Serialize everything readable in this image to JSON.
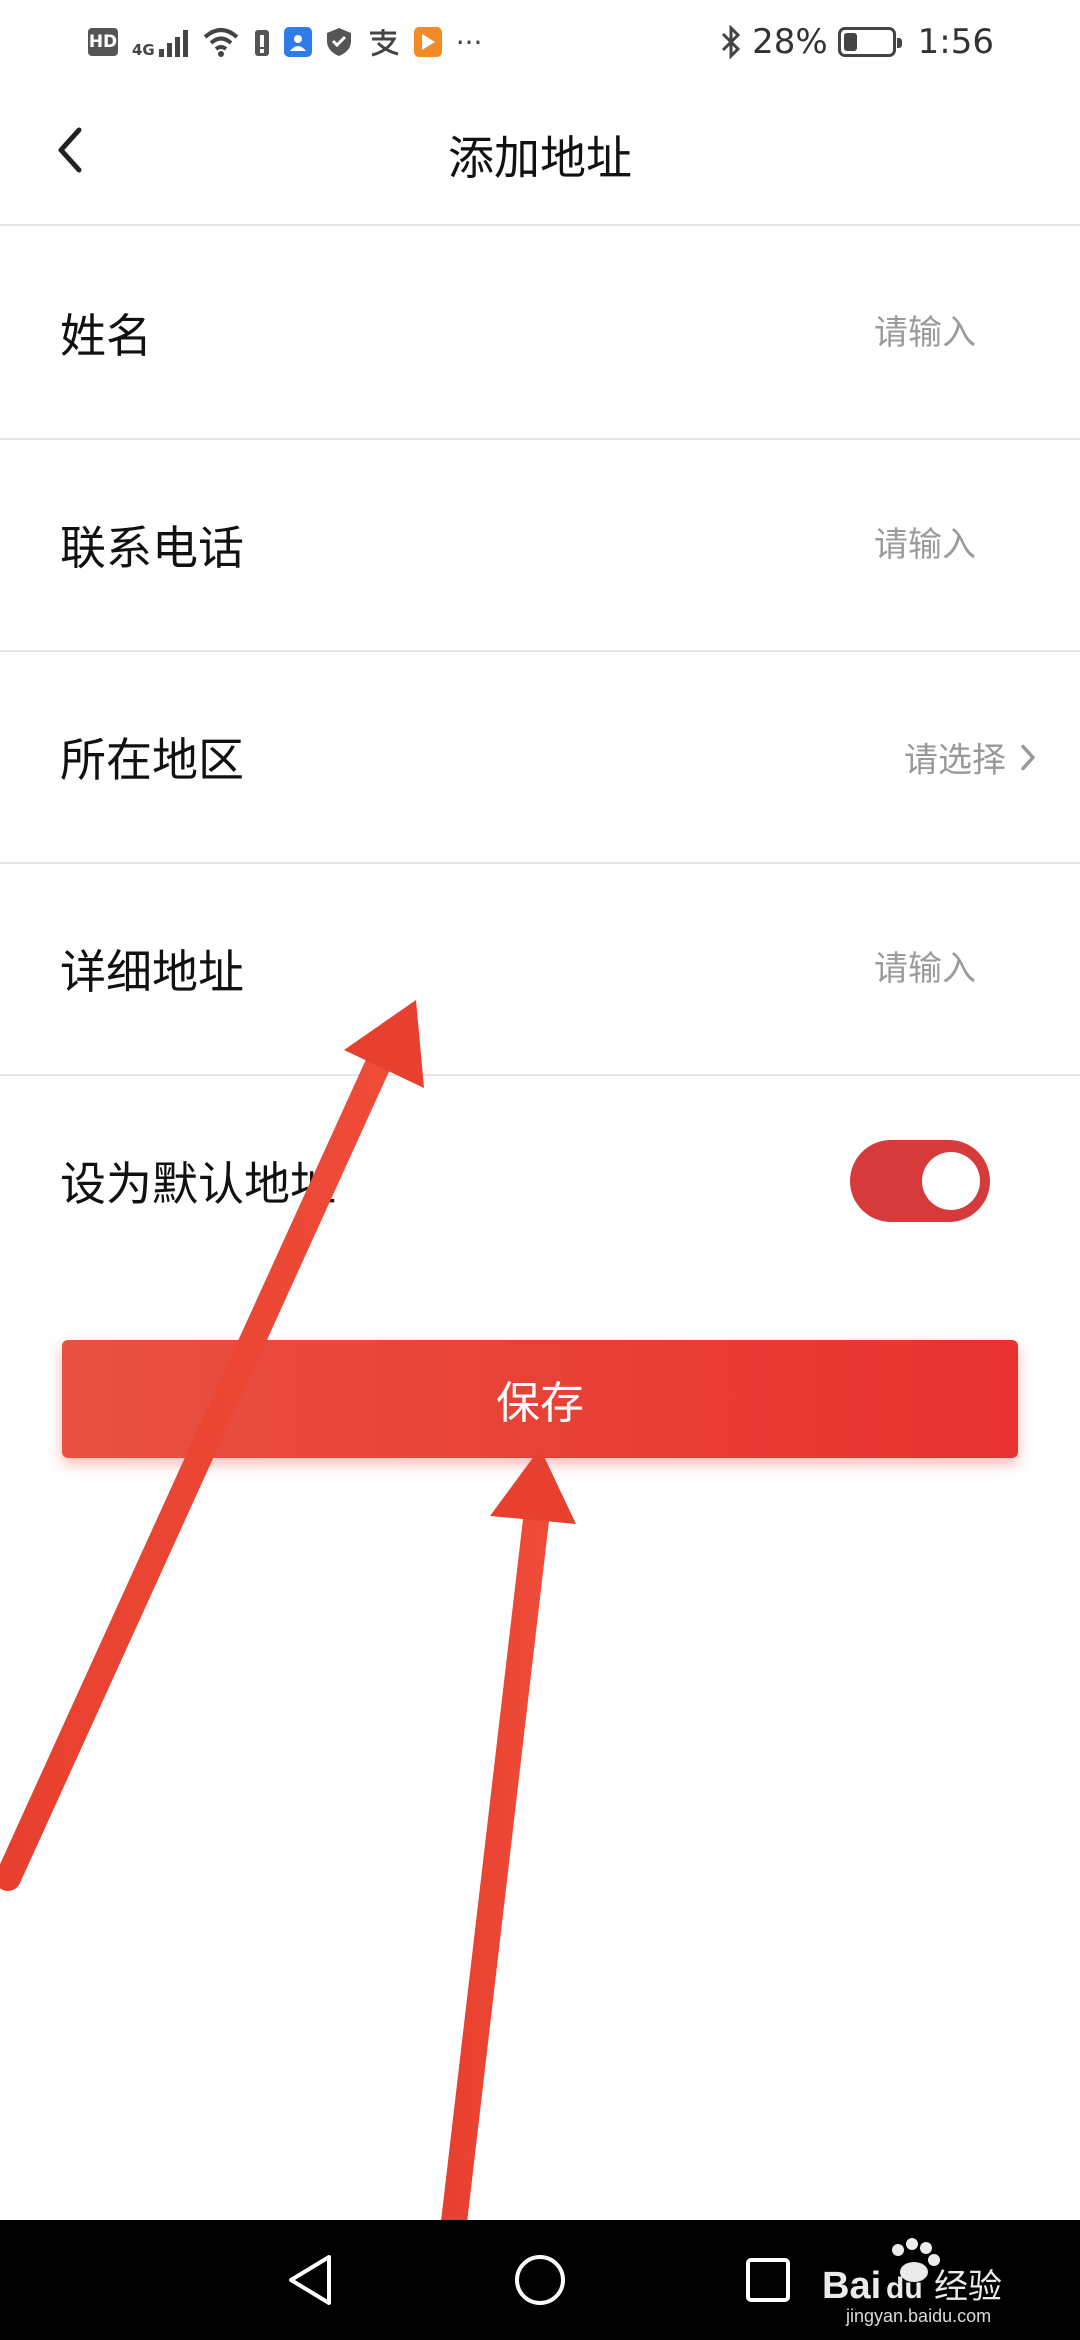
{
  "status_bar": {
    "battery_percent": "28%",
    "battery_level": 0.28,
    "time": "1:56",
    "hd_label": "HD",
    "network_label": "4G"
  },
  "header": {
    "title": "添加地址"
  },
  "form": {
    "name": {
      "label": "姓名",
      "placeholder": "请输入"
    },
    "phone": {
      "label": "联系电话",
      "placeholder": "请输入"
    },
    "region": {
      "label": "所在地区",
      "placeholder": "请选择"
    },
    "address": {
      "label": "详细地址",
      "placeholder": "请输入"
    },
    "default": {
      "label": "设为默认地址",
      "enabled": true
    }
  },
  "save_button": {
    "label": "保存"
  },
  "colors": {
    "accent": "#e8322f",
    "toggle_on": "#d63a3a",
    "placeholder": "#999999",
    "divider": "#e6e6e6"
  },
  "watermark": {
    "brand": "Baidu经验",
    "site": "jingyan.baidu.com"
  }
}
